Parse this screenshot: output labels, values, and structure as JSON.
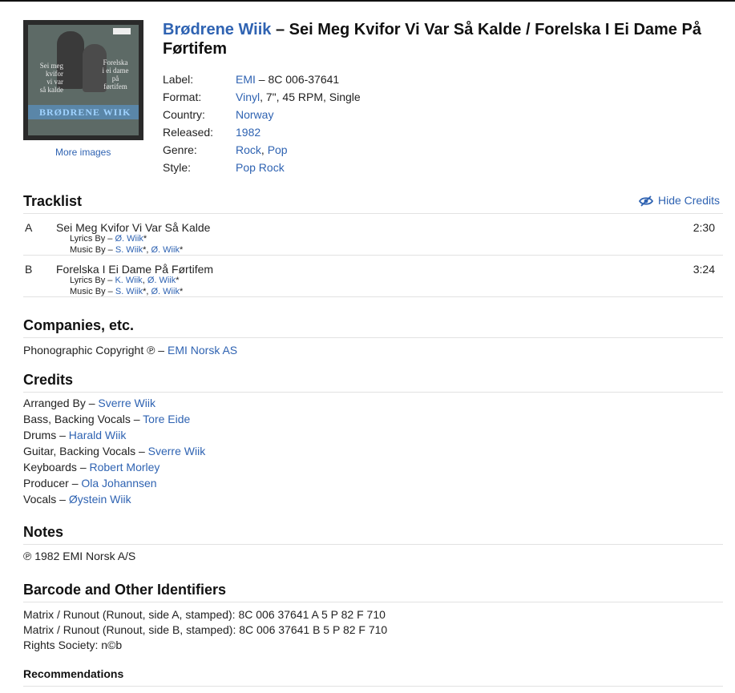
{
  "release": {
    "artist": "Brødrene Wiik",
    "separator": " – ",
    "title": "Sei Meg Kvifor Vi Var Så Kalde / Forelska I Ei Dame På Førtifem",
    "more_images": "More images",
    "cover": {
      "band_name": "BRØDRENE WIIK",
      "left_text": [
        "Sei meg",
        "kvifor",
        "vi var",
        "så kalde"
      ],
      "right_text": [
        "Forelska",
        "i ei dame",
        "på",
        "førtifem"
      ]
    },
    "info": [
      {
        "label": "Label:",
        "parts": [
          {
            "text": "EMI",
            "link": true
          },
          {
            "text": " – 8C 006-37641",
            "link": false
          }
        ]
      },
      {
        "label": "Format:",
        "parts": [
          {
            "text": "Vinyl",
            "link": true
          },
          {
            "text": ", 7\", 45 RPM, Single",
            "link": false
          }
        ]
      },
      {
        "label": "Country:",
        "parts": [
          {
            "text": "Norway",
            "link": true
          }
        ]
      },
      {
        "label": "Released:",
        "parts": [
          {
            "text": "1982",
            "link": true
          }
        ]
      },
      {
        "label": "Genre:",
        "parts": [
          {
            "text": "Rock",
            "link": true
          },
          {
            "text": ", ",
            "link": false
          },
          {
            "text": "Pop",
            "link": true
          }
        ]
      },
      {
        "label": "Style:",
        "parts": [
          {
            "text": "Pop Rock",
            "link": true
          }
        ]
      }
    ]
  },
  "tracklist": {
    "heading": "Tracklist",
    "hide_credits": "Hide Credits",
    "tracks": [
      {
        "position": "A",
        "title": "Sei Meg Kvifor Vi Var Så Kalde",
        "duration": "2:30",
        "credits": [
          {
            "role": "Lyrics By – ",
            "parts": [
              {
                "text": "Ø. Wiik",
                "link": true
              },
              {
                "text": "*",
                "link": false
              }
            ]
          },
          {
            "role": "Music By – ",
            "parts": [
              {
                "text": "S. Wiik",
                "link": true
              },
              {
                "text": "*, ",
                "link": false
              },
              {
                "text": "Ø. Wiik",
                "link": true
              },
              {
                "text": "*",
                "link": false
              }
            ]
          }
        ]
      },
      {
        "position": "B",
        "title": "Forelska I Ei Dame På Førtifem",
        "duration": "3:24",
        "credits": [
          {
            "role": "Lyrics By – ",
            "parts": [
              {
                "text": "K. Wiik",
                "link": true
              },
              {
                "text": ", ",
                "link": false
              },
              {
                "text": "Ø. Wiik",
                "link": true
              },
              {
                "text": "*",
                "link": false
              }
            ]
          },
          {
            "role": "Music By – ",
            "parts": [
              {
                "text": "S. Wiik",
                "link": true
              },
              {
                "text": "*, ",
                "link": false
              },
              {
                "text": "Ø. Wiik",
                "link": true
              },
              {
                "text": "*",
                "link": false
              }
            ]
          }
        ]
      }
    ]
  },
  "companies": {
    "heading": "Companies, etc.",
    "items": [
      {
        "role": "Phonographic Copyright ℗ – ",
        "name": "EMI Norsk AS"
      }
    ]
  },
  "credits": {
    "heading": "Credits",
    "items": [
      {
        "role": "Arranged By – ",
        "name": "Sverre Wiik"
      },
      {
        "role": "Bass, Backing Vocals – ",
        "name": "Tore Eide"
      },
      {
        "role": "Drums – ",
        "name": "Harald Wiik"
      },
      {
        "role": "Guitar, Backing Vocals – ",
        "name": "Sverre Wiik"
      },
      {
        "role": "Keyboards – ",
        "name": "Robert Morley"
      },
      {
        "role": "Producer – ",
        "name": "Ola Johannsen"
      },
      {
        "role": "Vocals – ",
        "name": "Øystein Wiik"
      }
    ]
  },
  "notes": {
    "heading": "Notes",
    "text": "℗ 1982 EMI Norsk A/S"
  },
  "identifiers": {
    "heading": "Barcode and Other Identifiers",
    "items": [
      "Matrix / Runout (Runout, side A, stamped): 8C 006 37641 A 5 P 82 F 710",
      "Matrix / Runout (Runout, side B, stamped): 8C 006 37641 B 5 P 82 F 710",
      "Rights Society: n©b"
    ]
  },
  "recommendations": {
    "heading": "Recommendations"
  },
  "colors": {
    "link": "#2f63b2",
    "text": "#222222",
    "divider": "#e2e2e2"
  }
}
